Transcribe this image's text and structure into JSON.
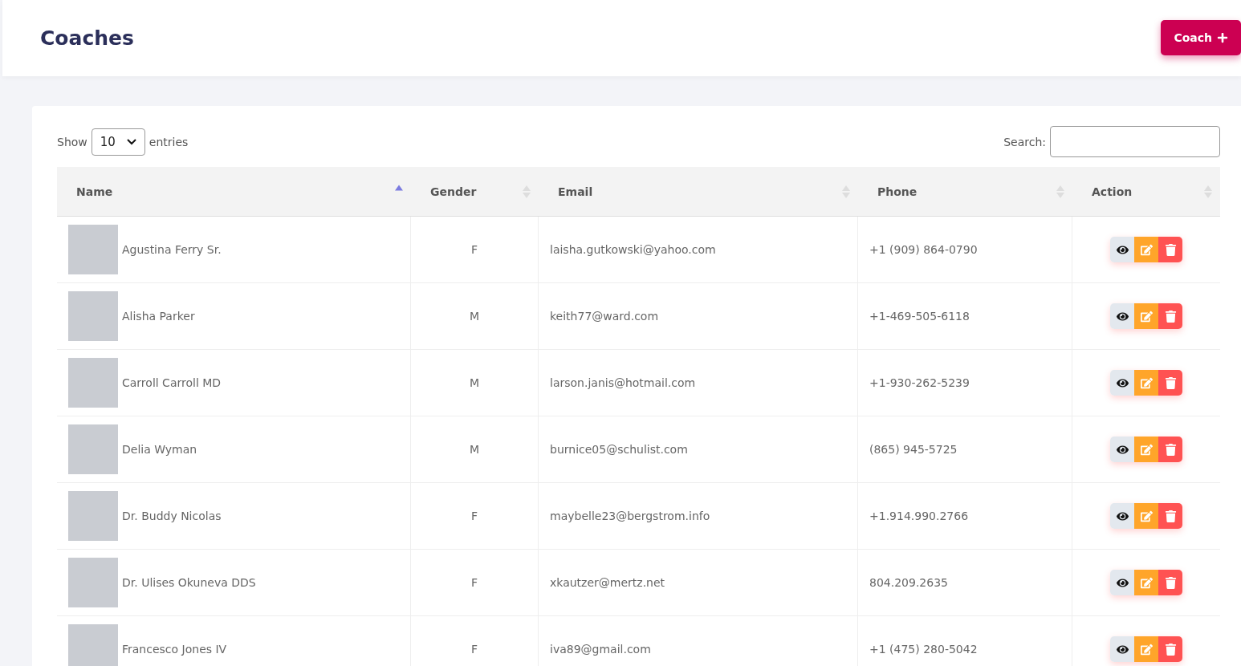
{
  "header": {
    "title": "Coaches",
    "add_button": "Coach"
  },
  "controls": {
    "show_label": "Show",
    "page_size": "10",
    "entries_label": "entries",
    "search_label": "Search:"
  },
  "table": {
    "columns": [
      {
        "label": "Name",
        "sorted": true
      },
      {
        "label": "Gender",
        "sorted": false
      },
      {
        "label": "Email",
        "sorted": false
      },
      {
        "label": "Phone",
        "sorted": false
      },
      {
        "label": "Action",
        "sorted": false
      }
    ],
    "rows": [
      {
        "name": "Agustina Ferry Sr.",
        "gender": "F",
        "email": "laisha.gutkowski@yahoo.com",
        "phone": "+1 (909) 864-0790"
      },
      {
        "name": "Alisha Parker",
        "gender": "M",
        "email": "keith77@ward.com",
        "phone": "+1-469-505-6118"
      },
      {
        "name": "Carroll Carroll MD",
        "gender": "M",
        "email": "larson.janis@hotmail.com",
        "phone": "+1-930-262-5239"
      },
      {
        "name": "Delia Wyman",
        "gender": "M",
        "email": "burnice05@schulist.com",
        "phone": "(865) 945-5725"
      },
      {
        "name": "Dr. Buddy Nicolas",
        "gender": "F",
        "email": "maybelle23@bergstrom.info",
        "phone": "+1.914.990.2766"
      },
      {
        "name": "Dr. Ulises Okuneva DDS",
        "gender": "F",
        "email": "xkautzer@mertz.net",
        "phone": "804.209.2635"
      },
      {
        "name": "Francesco Jones IV",
        "gender": "F",
        "email": "iva89@gmail.com",
        "phone": "+1 (475) 280-5042"
      }
    ]
  }
}
